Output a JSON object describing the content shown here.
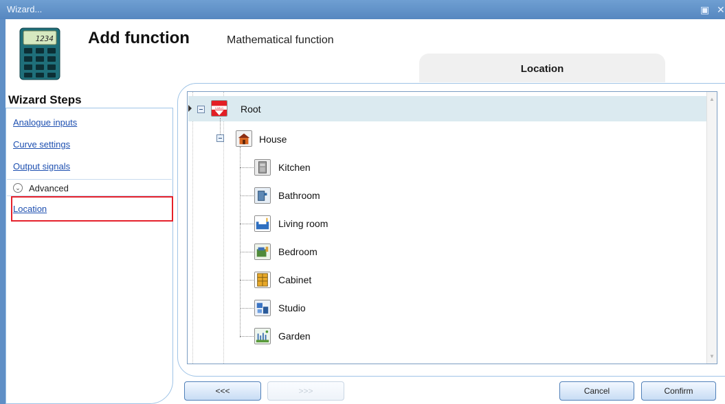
{
  "window": {
    "title": "Wizard...",
    "restore_icon": "restore-icon",
    "close_icon": "close-icon"
  },
  "header": {
    "icon": "calculator-icon",
    "calc_display": "1234",
    "title": "Add function",
    "subtitle": "Mathematical function",
    "tab_label": "Location"
  },
  "sidebar": {
    "heading": "Wizard Steps",
    "steps": [
      {
        "label": "Analogue inputs"
      },
      {
        "label": "Curve settings"
      },
      {
        "label": "Output signals"
      }
    ],
    "advanced_label": "Advanced",
    "advanced_icon": "chevron-down-icon",
    "active_step": "Location"
  },
  "tree": {
    "root": {
      "label": "Root",
      "icon": "carlo-gavazzi-logo-icon",
      "expanded": true,
      "selected": true
    },
    "house": {
      "label": "House",
      "icon": "house-icon",
      "expanded": true
    },
    "rooms": [
      {
        "label": "Kitchen",
        "icon": "kitchen-icon"
      },
      {
        "label": "Bathroom",
        "icon": "bathroom-icon"
      },
      {
        "label": "Living room",
        "icon": "living-room-icon"
      },
      {
        "label": "Bedroom",
        "icon": "bedroom-icon"
      },
      {
        "label": "Cabinet",
        "icon": "cabinet-icon"
      },
      {
        "label": "Studio",
        "icon": "studio-icon"
      },
      {
        "label": "Garden",
        "icon": "garden-icon"
      }
    ]
  },
  "buttons": {
    "back": "<<<",
    "next": ">>>",
    "cancel": "Cancel",
    "confirm": "Confirm"
  },
  "colors": {
    "titlebar": "#5f8fc6",
    "panel_border": "#9ec3e6",
    "highlight": "#e5202a",
    "selected_row": "#dbeaf0",
    "link": "#1d4fb0"
  }
}
